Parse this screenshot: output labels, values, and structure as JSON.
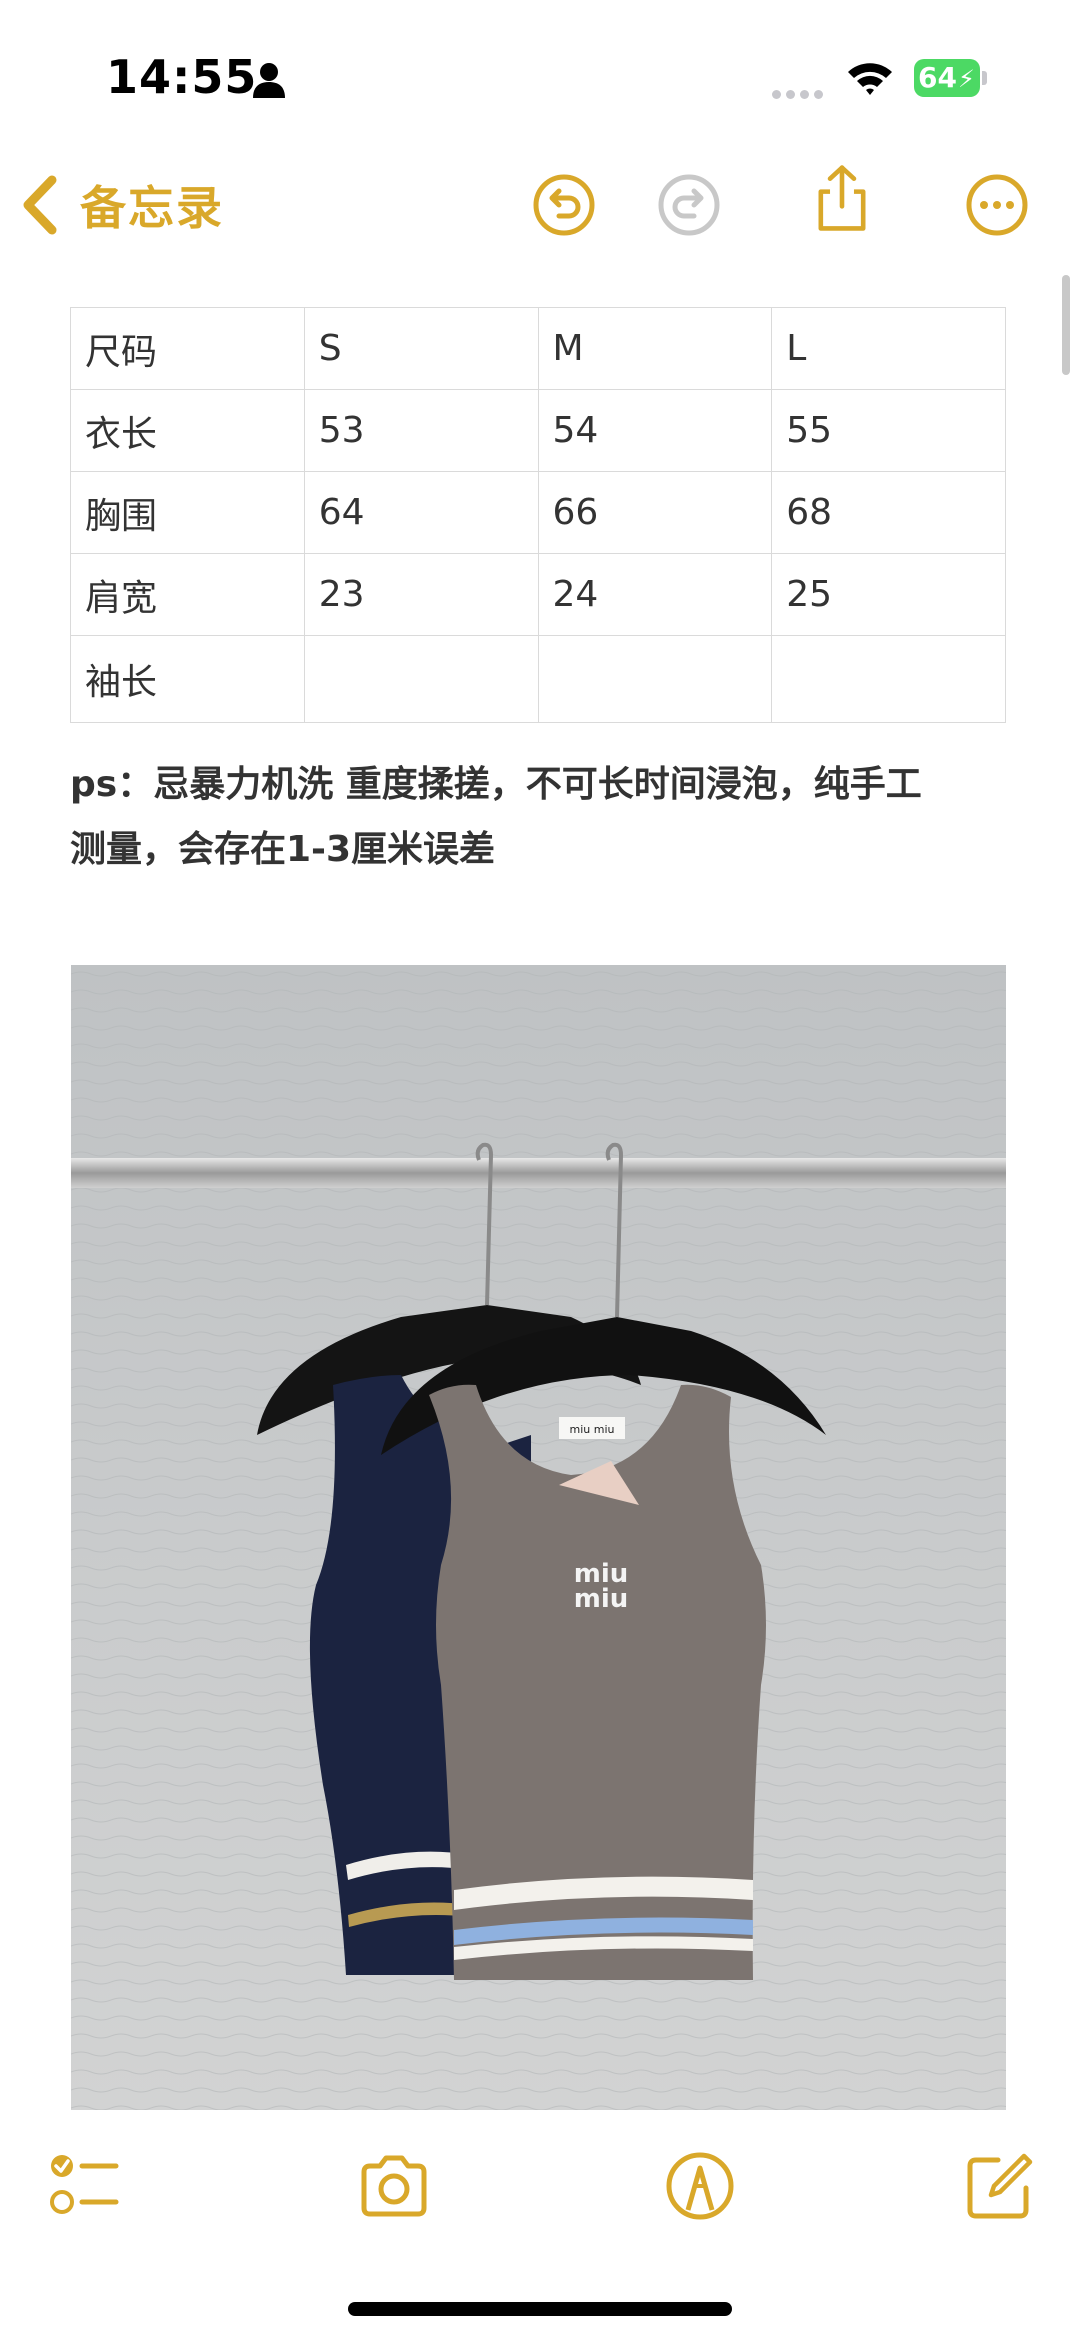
{
  "status_bar": {
    "time": "14:55",
    "battery_level": "64",
    "icons": [
      "person-icon",
      "signal-dots",
      "wifi-icon",
      "battery-icon"
    ]
  },
  "nav": {
    "back_label": "备忘录",
    "accent_color": "#d9a82a",
    "icons": [
      "chevron-left-icon",
      "undo-icon",
      "redo-icon",
      "share-icon",
      "more-icon"
    ]
  },
  "size_table": {
    "rows": [
      [
        "尺码",
        "S",
        "M",
        "L"
      ],
      [
        "衣长",
        "53",
        "54",
        "55"
      ],
      [
        "胸围",
        "64",
        "66",
        "68"
      ],
      [
        "肩宽",
        "23",
        "24",
        "25"
      ],
      [
        "袖长",
        "",
        "",
        ""
      ]
    ]
  },
  "note": {
    "line1": "ps：忌暴力机洗 重度揉搓，不可长时间浸泡，纯手工",
    "line2": "测量，会存在1-3厘米误差"
  },
  "photo": {
    "label_text": "miu miu",
    "logo_line1": "miu",
    "logo_line2": "miu"
  },
  "toolbar": {
    "icons": [
      "checklist-icon",
      "camera-icon",
      "markup-icon",
      "compose-icon"
    ]
  }
}
